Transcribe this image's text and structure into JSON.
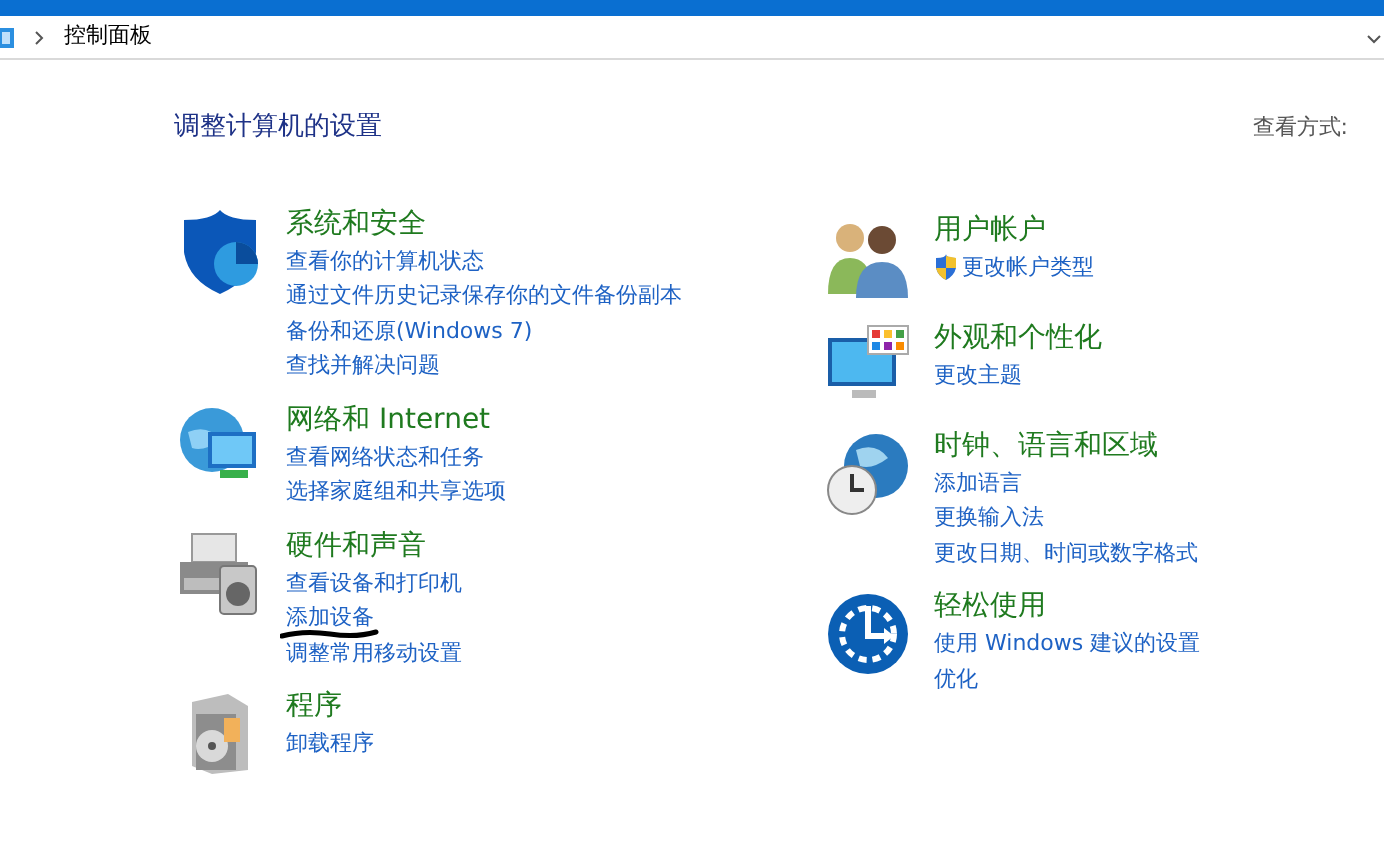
{
  "address_bar": {
    "path": "控制面板"
  },
  "heading": "调整计算机的设置",
  "view_by": {
    "label": "查看方式:"
  },
  "columns": [
    [
      {
        "kind": "security",
        "title": "系统和安全",
        "shield": false,
        "links": [
          "查看你的计算机状态",
          "通过文件历史记录保存你的文件备份副本",
          "备份和还原(Windows 7)",
          "查找并解决问题"
        ]
      },
      {
        "kind": "network",
        "title": "网络和 Internet",
        "shield": false,
        "links": [
          "查看网络状态和任务",
          "选择家庭组和共享选项"
        ]
      },
      {
        "kind": "hardware",
        "title": "硬件和声音",
        "shield": false,
        "links": [
          "查看设备和打印机",
          "添加设备",
          "调整常用移动设置"
        ]
      },
      {
        "kind": "programs",
        "title": "程序",
        "shield": false,
        "links": [
          "卸载程序"
        ]
      }
    ],
    [
      {
        "kind": "users",
        "title": "用户帐户",
        "shield": true,
        "links": [
          "更改帐户类型"
        ]
      },
      {
        "kind": "appearance",
        "title": "外观和个性化",
        "shield": false,
        "links": [
          "更改主题"
        ]
      },
      {
        "kind": "clock",
        "title": "时钟、语言和区域",
        "shield": false,
        "links": [
          "添加语言",
          "更换输入法",
          "更改日期、时间或数字格式"
        ]
      },
      {
        "kind": "ease",
        "title": "轻松使用",
        "shield": false,
        "links": [
          "使用 Windows 建议的设置",
          "优化"
        ]
      }
    ]
  ]
}
